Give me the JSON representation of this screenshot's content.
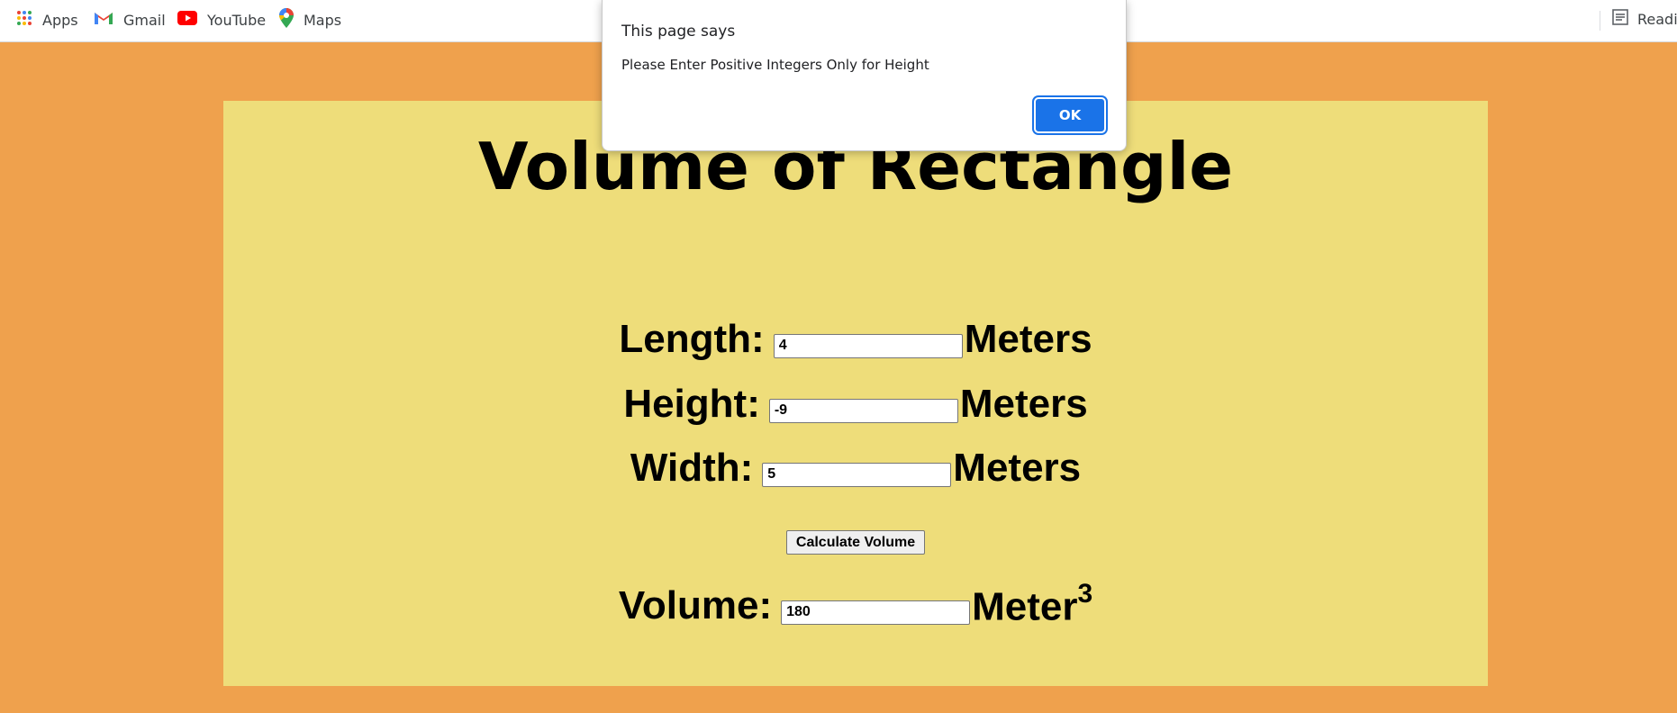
{
  "bookmarks": {
    "items": [
      {
        "label": "Apps",
        "icon": "apps-grid-icon"
      },
      {
        "label": "Gmail",
        "icon": "gmail-icon"
      },
      {
        "label": "YouTube",
        "icon": "youtube-icon"
      },
      {
        "label": "Maps",
        "icon": "maps-icon"
      }
    ],
    "reading_list_label": "Readir"
  },
  "page": {
    "title": "Volume of Rectangle",
    "length": {
      "label": "Length:",
      "value": "4",
      "unit": "Meters"
    },
    "height": {
      "label": "Height:",
      "value": "-9",
      "unit": "Meters"
    },
    "width": {
      "label": "Width:",
      "value": "5",
      "unit": "Meters"
    },
    "calculate_button": "Calculate Volume",
    "volume": {
      "label": "Volume:",
      "value": "180",
      "unit": "Meter",
      "unit_exponent": "3"
    }
  },
  "dialog": {
    "title": "This page says",
    "message": "Please Enter Positive Integers Only for Height",
    "ok_label": "OK"
  },
  "colors": {
    "background": "#efa14d",
    "panel": "#eedd7a",
    "ok_button": "#1a73e8"
  }
}
